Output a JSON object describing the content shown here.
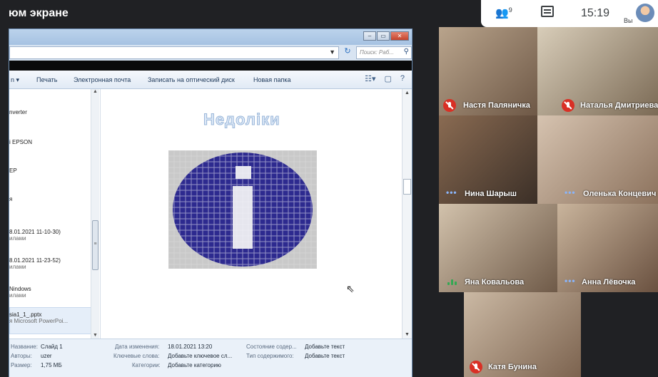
{
  "header": {
    "presentation_title": "юм экране",
    "participants_count": "9",
    "time": "15:19",
    "you_label": "Вы"
  },
  "explorer": {
    "search_placeholder": "Поиск: Раб...",
    "toolbar": [
      "Печать",
      "Электронная почта",
      "Записать на оптический диск",
      "Новая папка"
    ],
    "nav_items": [
      {
        "line1": "nverter",
        "line2": ""
      },
      {
        "line1": "i EPSON",
        "line2": ""
      },
      {
        "line1": "EP",
        "line2": ""
      },
      {
        "line1": "я",
        "line2": ""
      },
      {
        "line1": "8.01.2021 11-10-30)",
        "line2": "илами"
      },
      {
        "line1": "8.01.2021 11-23-52)",
        "line2": "илами"
      },
      {
        "line1": "Nindows",
        "line2": "илами"
      },
      {
        "line1": "sia1_1_.pptx",
        "line2": "я Microsoft PowerPoi..."
      }
    ],
    "slide_title": "Недоліки",
    "details": {
      "title_label": "Название:",
      "title_value": "Слайд 1",
      "authors_label": "Авторы:",
      "authors_value": "uzer",
      "size_label": "Размер:",
      "size_value": "1,75 МБ",
      "modified_label": "Дата изменения:",
      "modified_value": "18.01.2021 13:20",
      "keywords_label": "Ключевые слова:",
      "keywords_value": "Добавьте ключевое сл...",
      "categories_label": "Категории:",
      "categories_value": "Добавьте категорию",
      "state_label": "Состояние содер...",
      "state_value": "Добавьте текст",
      "type_label": "Тип содержимого:",
      "type_value": "Добавьте текст"
    }
  },
  "participants": [
    {
      "name": "Настя Паляничка",
      "status": "muted"
    },
    {
      "name": "Наталья Дмитриева",
      "status": "muted"
    },
    {
      "name": "Нина Шарыш",
      "status": "more"
    },
    {
      "name": "Оленька Концевич",
      "status": "more"
    },
    {
      "name": "Яна Ковальова",
      "status": "speaking"
    },
    {
      "name": "Анна Лёвочка",
      "status": "more"
    },
    {
      "name": "Катя Бунина",
      "status": "muted"
    }
  ],
  "colors": {
    "mic_off": "#d93025",
    "speaking": "#34a853",
    "accent": "#8ab4f8"
  }
}
